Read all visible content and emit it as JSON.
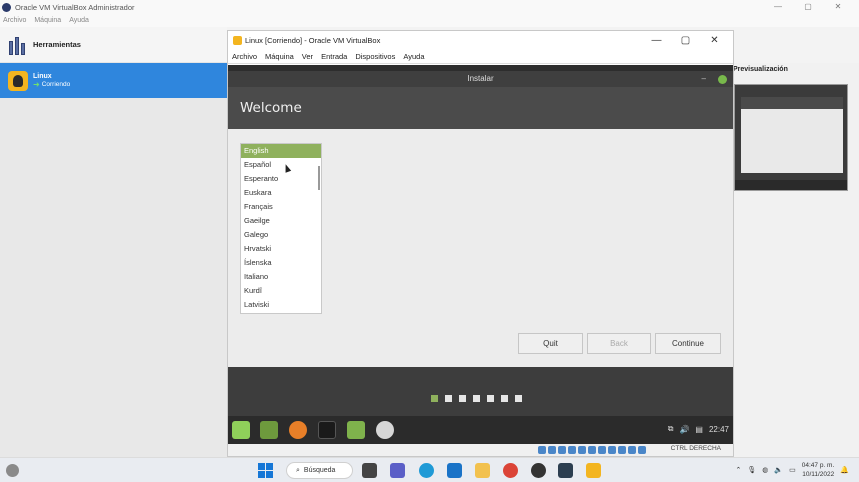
{
  "host": {
    "title": "Oracle VM VirtualBox Administrador",
    "menu": [
      "Archivo",
      "Máquina",
      "Ayuda"
    ],
    "tools_label": "Herramientas",
    "vm": {
      "name": "Linux",
      "state": "Corriendo"
    },
    "preview_label": "Previsualización",
    "window_controls": [
      "—",
      "▢",
      "✕"
    ]
  },
  "vmwindow": {
    "title": "Linux [Corriendo] - Oracle VM VirtualBox",
    "menu": [
      "Archivo",
      "Máquina",
      "Ver",
      "Entrada",
      "Dispositivos",
      "Ayuda"
    ],
    "controls": [
      "—",
      "▢",
      "✕"
    ]
  },
  "installer": {
    "title": "Instalar",
    "heading": "Welcome",
    "languages": [
      "English",
      "Español",
      "Esperanto",
      "Euskara",
      "Français",
      "Gaeilge",
      "Galego",
      "Hrvatski",
      "Íslenska",
      "Italiano",
      "Kurdî",
      "Latviski"
    ],
    "selected_language": "English",
    "buttons": {
      "quit": "Quit",
      "back": "Back",
      "continue": "Continue"
    },
    "progress_steps": 7,
    "progress_current": 1
  },
  "guest_taskbar": {
    "time": "22:47"
  },
  "statusbar": {
    "host_key": "CTRL DERECHA"
  },
  "windows_taskbar": {
    "search_label": "Búsqueda",
    "time": "04:47 p. m.",
    "date": "10/11/2022"
  }
}
